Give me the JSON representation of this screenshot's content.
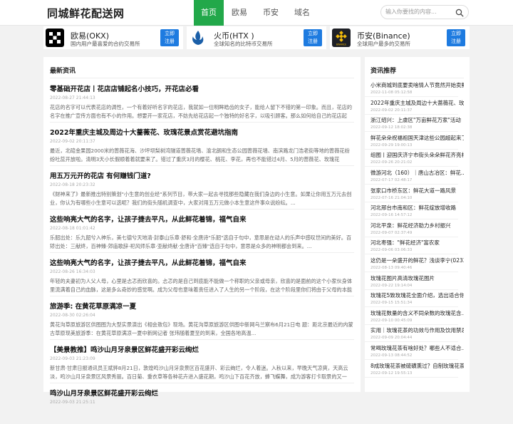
{
  "header": {
    "logo": "同城鲜花配送网",
    "nav": [
      "首页",
      "欧易",
      "币安",
      "域名"
    ],
    "search_placeholder": "输入你要找的内容..."
  },
  "cards": [
    {
      "name": "欧易(OKX)",
      "desc": "国内用户最喜爱的合约交易所",
      "btn1": "立即",
      "btn2": "注册",
      "logo_color": "#000000"
    },
    {
      "name": "火币(HTX )",
      "desc": "全球知名的比特币交易所",
      "btn1": "立即",
      "btn2": "注册",
      "logo_color": "#1b5fa8"
    },
    {
      "name": "币安(Binance)",
      "desc": "全球用户最多的交易所",
      "btn1": "立即",
      "btn2": "注册",
      "logo_color": "#1e2026"
    }
  ],
  "main": {
    "title": "最新资讯",
    "articles": [
      {
        "title": "零基础开花店丨花店店铺起名小技巧，开花店必看",
        "date": "2022-08-27 21:44:13",
        "body": "花店的名字可以代表花店的调性，一个有着好听名字的花店，我就如一位明眸皓齿的女子，能给人留下不错的第一印象。而且，花店的名字在推广宣传方面也有不小的作用。想要开一家花店，不妨先给花店起一个独特的好名字，以吸引顾客。那么如何给自己的花店起一..."
      },
      {
        "title": "2022年重庆主城及周边十大蔷薇花、玫瑰花景点赏花避坑指南",
        "date": "2022-09-02 20:11:37",
        "body": "最近，北碚金果园2000米的蔷薇花海、沙坪坝梨树湾隧道蔷薇花墙、渝北朗和生态公园蔷薇花墙、南滨路龙门浩老街等地的蔷薇花纷纷吐蕊开放啦。清明3天小长假顺着着就要来了。错过了重庆3月的樱花、桃花、李花，再也不能错过4月、5月的蔷薇花、玫瑰花哦。..."
      },
      {
        "title": "用五万元开的花店 有何赚钱门道?",
        "date": "2022-08-18 20:23:32",
        "body": "《财神来了》最新推出特别策划\"小生意的创业经\"系列节目，带大家一起去寻找那些隐藏在我们身边的小生意。如果让你用五万元去创业，你认为有哪些小生意可以选呢？我们的街头随机调查中，大家对用五万元做小本生意这件事众说纷纭。..."
      },
      {
        "title": "这些响亮大气的名字，让孩子捷去平凡，从此鲜花着锦，福气自来",
        "date": "2022-08-18 01:01:42",
        "body": "乐韶出处：乐九韶兮入神乐，美七德兮天地清·封泰山乐章·舒和·全唐诗\"乐韶\"选自于句中，意思是在动人的乐声中感叹世间的美好。百矫出处：三献终，百神臻·郊庙歌辞·祀风师乐章·亚献终献·全唐诗\"百臻\"选自于句中，意思是众多的神明都会到来。..."
      },
      {
        "title": "这些响亮大气的名字，让孩子捷去平凡，从此鲜花着锦，福气自来",
        "date": "2022-08-26 16:34:03",
        "body": "年轻的夫妻初为人父人母，心里是忐忑而欣喜的。忐忑的是自己到底能不能做一个称职的父亲或母亲，欣喜的是面前的这个小家伙身体里流满着自己的血脉，这是多么奇妙的感觉啊。成为父母也意味着责任进入了人生的另一个阶段，在这个阶段里你们将由于父母的本能而..."
      },
      {
        "title": "旅游季: 在黄花草原满凉一夏",
        "date": "2022-08-30 02:26:04",
        "body": "黄花沟草原旅游区供图图为大型实景演出《相会敖包》现场。黄花沟草原旅游区供图中新网乌兰察布6月21日电 题：距北京最近的内蒙古草原现美旅游季：在黄花草原满凉一夏中新网记者 张玮随着夏至的到来，全国各地高温..."
      },
      {
        "title": "【美景教推】鸣沙山月牙泉景区鲜花盛开彩云绚烂",
        "date": "2022-09-03 21:23:09",
        "body": "新甘肃·甘肃日报通讯员王斌骅8月21日，敦煌鸣沙山月牙泉景区百花盛开、彩云绚烂，令人着迷。入秋以来，早晚天气凉爽，天高云淡，鸣沙山月牙泉景区风景秀丽。百日菊、重衣草等各种花卉进入盛花期，鸣沙山下百花齐放，蜂飞蝶舞，成为游客打卡取景的又一网..."
      },
      {
        "title": "鸣沙山月牙泉景区鲜花盛开彩云绚烂",
        "date": "2022-09-03 21:25:11",
        "body": ""
      }
    ]
  },
  "side": {
    "title": "资讯推荐",
    "items": [
      {
        "title": "小米商城到底要卖啥情人节竟然开始卖鲜花了",
        "date": "2022-11-08 05:12:58"
      },
      {
        "title": "2022年重庆主城及周边十大蔷薇花、玫瑰花景点",
        "date": "2022-09-02 20:11:37"
      },
      {
        "title": "浙江绍兴：上虞区\"万亩鲜花万家\"活动",
        "date": "2022-09-12 18:02:38"
      },
      {
        "title": "鲜花朵朵祝福祖国天津这些公园超起来了",
        "date": "2022-09-29 19:00:13"
      },
      {
        "title": "组图丨迎国庆济宁市街头朵朵鲜花齐亮相",
        "date": "2022-09-26 20:21:02"
      },
      {
        "title": "微游河北（160）｜唐山古冶区：鲜花...",
        "date": "2022-07-17 02:48:17"
      },
      {
        "title": "张家口市桥东区：鲜花大道一路风景",
        "date": "2022-07-16 21:04:10"
      },
      {
        "title": "河北邢台市南和区：鲜花绽放增收路",
        "date": "2022-09-16 14:57:12"
      },
      {
        "title": "河北平泉：鲜花经济助力乡村振兴",
        "date": "2022-09-07 02:37:49"
      },
      {
        "title": "河北枣强：\"鲜花经济\"富农家",
        "date": "2022-09-06 03:06:33"
      },
      {
        "title": "这仍是一朵盛开的鲜花？浅谈李宁(02331)...",
        "date": "2022-08-13 09:40:46"
      },
      {
        "title": "玫瑰花图片高清玫瑰花图片",
        "date": "2022-09-22 19:14:04"
      },
      {
        "title": "玫瑰花5致玫瑰花全面介绍，选出适合你的",
        "date": "2022-09-15 15:51:34"
      },
      {
        "title": "玫瑰花数量的含义不同朵数的玫瑰花含...",
        "date": "2022-09-10 00:45:09"
      },
      {
        "title": "实用｜玫瑰花茶的功效与作用及饮用禁忌",
        "date": "2022-09-09 20:04:44"
      },
      {
        "title": "常喝玫瑰花茶有啥好处？哪些人不适合...",
        "date": "2022-09-13 08:44:52"
      },
      {
        "title": "8成玫瑰花茶被硫磺熏过？自制玫瑰花茶...",
        "date": "2022-09-12 19:55:13"
      }
    ]
  }
}
